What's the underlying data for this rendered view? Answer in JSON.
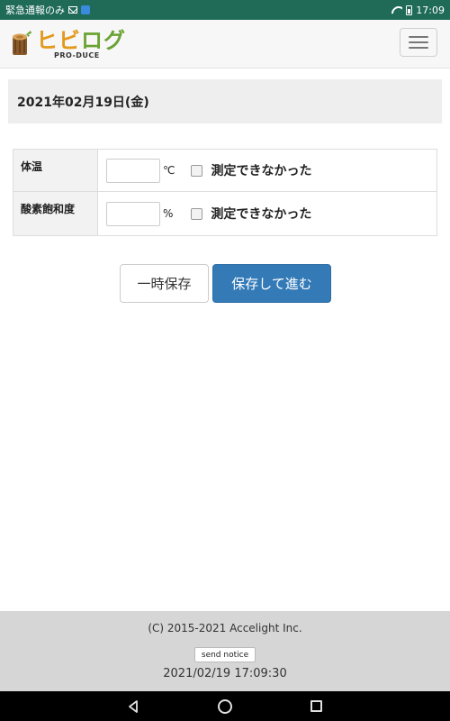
{
  "status_bar": {
    "notification_text": "緊急通報のみ",
    "time": "17:09",
    "icons": [
      "mail-icon",
      "app-notification-icon",
      "wifi-icon",
      "battery-icon"
    ]
  },
  "header": {
    "logo_main_1": "ヒビ",
    "logo_main_2": "ログ",
    "logo_sub": "PRO-DUCE",
    "menu_icon": "hamburger-menu-icon"
  },
  "date_banner": {
    "text": "2021年02月19日(金)"
  },
  "measurements": {
    "rows": [
      {
        "label": "体温",
        "value": "",
        "unit": "℃",
        "checkbox_label": "測定できなかった",
        "checked": false
      },
      {
        "label": "酸素飽和度",
        "value": "",
        "unit": "%",
        "checkbox_label": "測定できなかった",
        "checked": false
      }
    ]
  },
  "actions": {
    "save_label": "一時保存",
    "next_label": "保存して進む",
    "next_color": "#337ab7"
  },
  "footer": {
    "copyright": "(C) 2015-2021 Accelight Inc.",
    "notice_button": "send notice",
    "timestamp": "2021/02/19 17:09:30"
  },
  "nav_bar": {
    "icons": [
      "back-icon",
      "home-icon",
      "recent-apps-icon"
    ]
  }
}
